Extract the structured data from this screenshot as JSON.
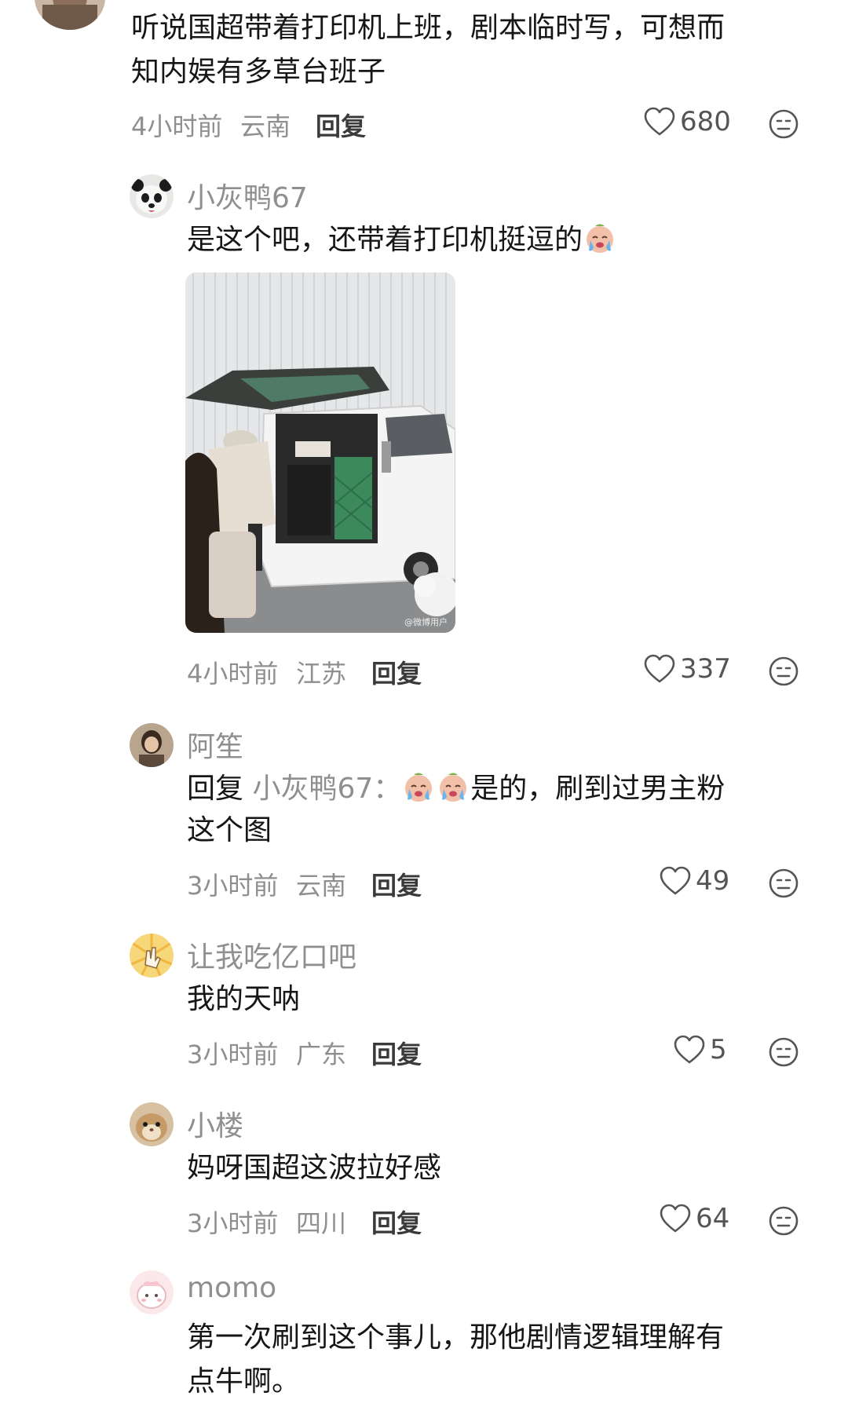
{
  "comments": [
    {
      "body_line1": "听说国超带着打印机上班，剧本临时写，可想而",
      "body_line2": "知内娱有多草台班子",
      "time": "4小时前",
      "location": "云南",
      "reply_label": "回复",
      "likes": "680"
    },
    {
      "username": "小灰鸭67",
      "body": "是这个吧，还带着打印机挺逗的",
      "emoji": "crying-face",
      "photo_watermark": "@微博用户",
      "time": "4小时前",
      "location": "江苏",
      "reply_label": "回复",
      "likes": "337"
    },
    {
      "username": "阿笙",
      "reply_prefix": "回复",
      "mention": "小灰鸭67：",
      "body_line1": "是的，刷到过男主粉",
      "body_line2": "这个图",
      "emoji": "crying-face",
      "time": "3小时前",
      "location": "云南",
      "reply_label": "回复",
      "likes": "49"
    },
    {
      "username": "让我吃亿口吧",
      "body": "我的天呐",
      "time": "3小时前",
      "location": "广东",
      "reply_label": "回复",
      "likes": "5"
    },
    {
      "username": "小楼",
      "body": "妈呀国超这波拉好感",
      "time": "3小时前",
      "location": "四川",
      "reply_label": "回复",
      "likes": "64"
    },
    {
      "username": "momo",
      "body_line1": "第一次刷到这个事儿，那他剧情逻辑理解有",
      "body_line2": "点牛啊。"
    }
  ],
  "colors": {
    "text_primary": "#161616",
    "text_secondary": "#8f8f8f",
    "background": "#ffffff"
  },
  "icons": {
    "like": "heart-outline-icon",
    "more": "neutral-face-icon"
  }
}
